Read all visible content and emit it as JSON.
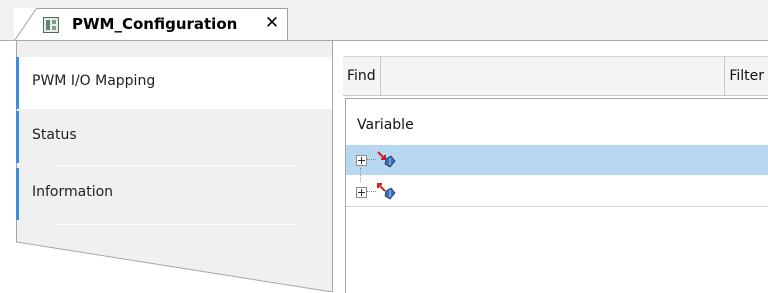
{
  "editor_tab": {
    "title": "PWM_Configuration",
    "close_glyph": "✕",
    "icon": "device-config-icon"
  },
  "side_panel": {
    "items": [
      {
        "label": "PWM I/O Mapping",
        "active": true
      },
      {
        "label": "Status",
        "active": false
      },
      {
        "label": "Information",
        "active": false
      }
    ]
  },
  "toolbar": {
    "find_label": "Find",
    "filter_label": "Filter"
  },
  "tree": {
    "column_header": "Variable",
    "rows": [
      {
        "icon": "input-variable-icon",
        "selected": true,
        "expanded": false
      },
      {
        "icon": "output-variable-icon",
        "selected": false,
        "expanded": false
      }
    ]
  },
  "colors": {
    "selection": "#b8d7f1",
    "accent": "#3c8fd8",
    "side_panel_bg": "#f0f0f0"
  }
}
